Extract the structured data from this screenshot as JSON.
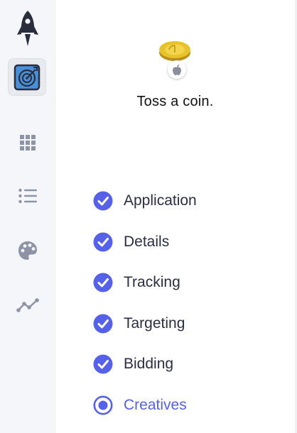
{
  "sidebar": {
    "items": [
      {
        "name": "rocket-icon",
        "active": false
      },
      {
        "name": "target-icon",
        "active": true
      },
      {
        "name": "grid-icon",
        "active": false
      },
      {
        "name": "list-icon",
        "active": false
      },
      {
        "name": "palette-icon",
        "active": false
      },
      {
        "name": "analytics-icon",
        "active": false
      }
    ]
  },
  "main": {
    "coin_icon": "coin-icon",
    "platform_badge": "apple-icon",
    "caption": "Toss a coin."
  },
  "steps": [
    {
      "label": "Application",
      "status": "completed"
    },
    {
      "label": "Details",
      "status": "completed"
    },
    {
      "label": "Tracking",
      "status": "completed"
    },
    {
      "label": "Targeting",
      "status": "completed"
    },
    {
      "label": "Bidding",
      "status": "completed"
    },
    {
      "label": "Creatives",
      "status": "current"
    }
  ],
  "colors": {
    "accent": "#5561e8",
    "sidebar_bg": "#f5f6f9",
    "sidebar_icon": "#8e93a5",
    "coin_gold": "#e8c22a"
  }
}
